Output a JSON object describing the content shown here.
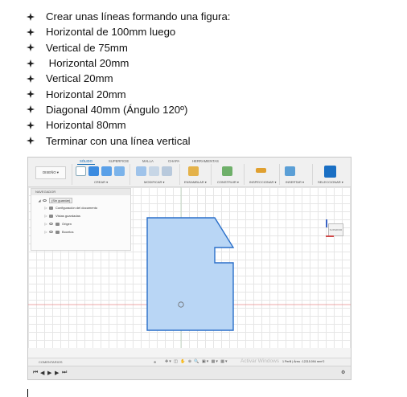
{
  "instructions": {
    "items": [
      "Crear unas líneas formando una figura:",
      "Horizontal de 100mm luego",
      "Vertical de 75mm",
      " Horizontal 20mm",
      "Vertical 20mm",
      "Horizontal 20mm",
      "Diagonal 40mm (Ángulo 120º)",
      "Horizontal 80mm",
      "Terminar con una línea vertical"
    ]
  },
  "app": {
    "tabs": [
      "SÓLIDO",
      "SUPERFICIE",
      "MALLA",
      "CHAPA",
      "HERRAMIENTAS"
    ],
    "active_tab": "SÓLIDO",
    "workspace_button": "DISEÑO ▾",
    "groups": [
      "CREAR ▾",
      "MODIFICAR ▾",
      "ENSAMBLAR ▾",
      "CONSTRUIR ▾",
      "INSPECCIONAR ▾",
      "INSERTAR ▾",
      "SELECCIONAR ▾"
    ],
    "navigator": {
      "title": "NAVEGADOR",
      "root": "(Sin guardar)",
      "rows": [
        "Configuración del documento",
        "Vistas guardadas",
        "Origen",
        "Bocetos"
      ]
    },
    "viewcube_label": "SUPERIOR",
    "comments_label": "COMENTARIOS",
    "status_text": "1 Perfil | Área : 12215.094 mm^2",
    "watermark_title": "Activar Windows",
    "watermark_sub": "Ve a Configuración para activar Windows.",
    "colors": {
      "profile_fill": "#b9d6f5",
      "profile_stroke": "#2a6fc9",
      "accent": "#0a64b0",
      "axis_red": "#e88a8a"
    }
  }
}
